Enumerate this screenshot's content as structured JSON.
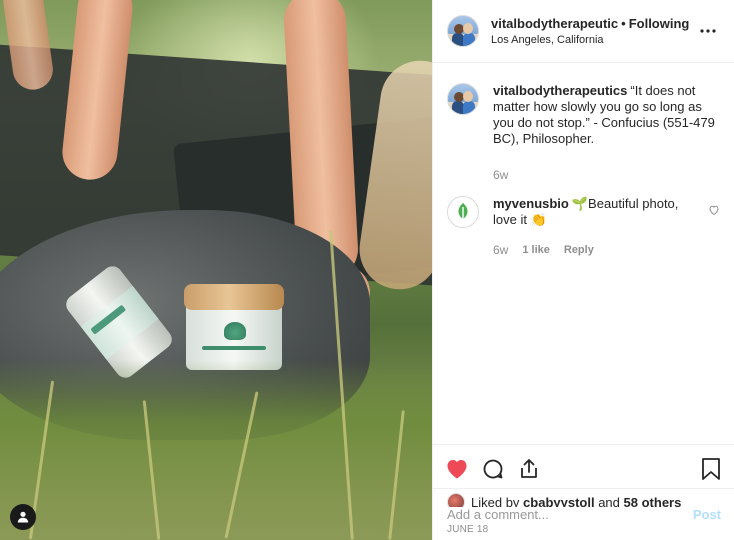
{
  "header": {
    "username": "vitalbodytherapeutic",
    "separator": "•",
    "follow_status": "Following",
    "location": "Los Angeles, California",
    "more_icon": "more-horizontal-icon"
  },
  "caption": {
    "username": "vitalbodytherapeutics",
    "text": "“It does not matter how slowly you go so long as you do not stop.” - Confucius (551-479 BC), Philosopher.",
    "age": "6w"
  },
  "comment": {
    "username": "myvenusbio",
    "text": "🌱Beautiful photo, love it 👏",
    "age": "6w",
    "likes": "1 like",
    "reply": "Reply"
  },
  "actions": {
    "like_icon": "heart-filled-icon",
    "comment_icon": "comment-icon",
    "share_icon": "share-icon",
    "save_icon": "bookmark-icon",
    "like_color": "#ed4956"
  },
  "likes": {
    "prefix": "Liked by",
    "user": "cbabyystoll",
    "middle": "and",
    "others": "58 others"
  },
  "date": "JUNE 18",
  "add_comment": {
    "placeholder": "Add a comment...",
    "post_label": "Post",
    "post_color": "#b2dffc"
  }
}
